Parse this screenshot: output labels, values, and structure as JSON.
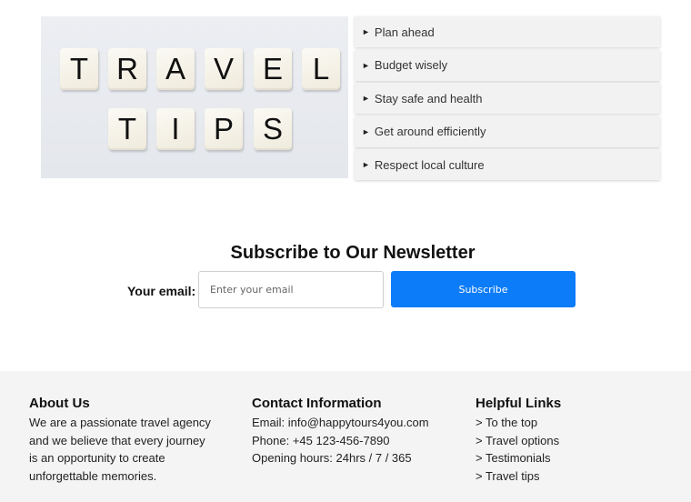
{
  "hero": {
    "row1": [
      "T",
      "R",
      "A",
      "V",
      "E",
      "L"
    ],
    "row2": [
      "T",
      "I",
      "P",
      "S"
    ]
  },
  "tips": [
    "Plan ahead",
    "Budget wisely",
    "Stay safe and health",
    "Get around efficiently",
    "Respect local culture"
  ],
  "tip_arrow": "►",
  "newsletter": {
    "title": "Subscribe to Our Newsletter",
    "email_label": "Your email:",
    "email_placeholder": "Enter your email",
    "email_value": "",
    "button_label": "Subscribe",
    "button_color": "#0d7cf8"
  },
  "footer": {
    "about": {
      "title": "About Us",
      "lines": [
        "We are a passionate travel agency",
        "and we believe that every journey",
        "is an opportunity to create",
        "unforgettable memories."
      ]
    },
    "contact": {
      "title": "Contact Information",
      "lines": [
        "Email: info@happytours4you.com",
        "Phone: +45 123-456-7890",
        "Opening hours: 24hrs / 7 / 365"
      ]
    },
    "links": {
      "title": "Helpful Links",
      "items": [
        "> To the top",
        "> Travel options",
        "> Testimonials",
        "> Travel tips"
      ]
    }
  }
}
